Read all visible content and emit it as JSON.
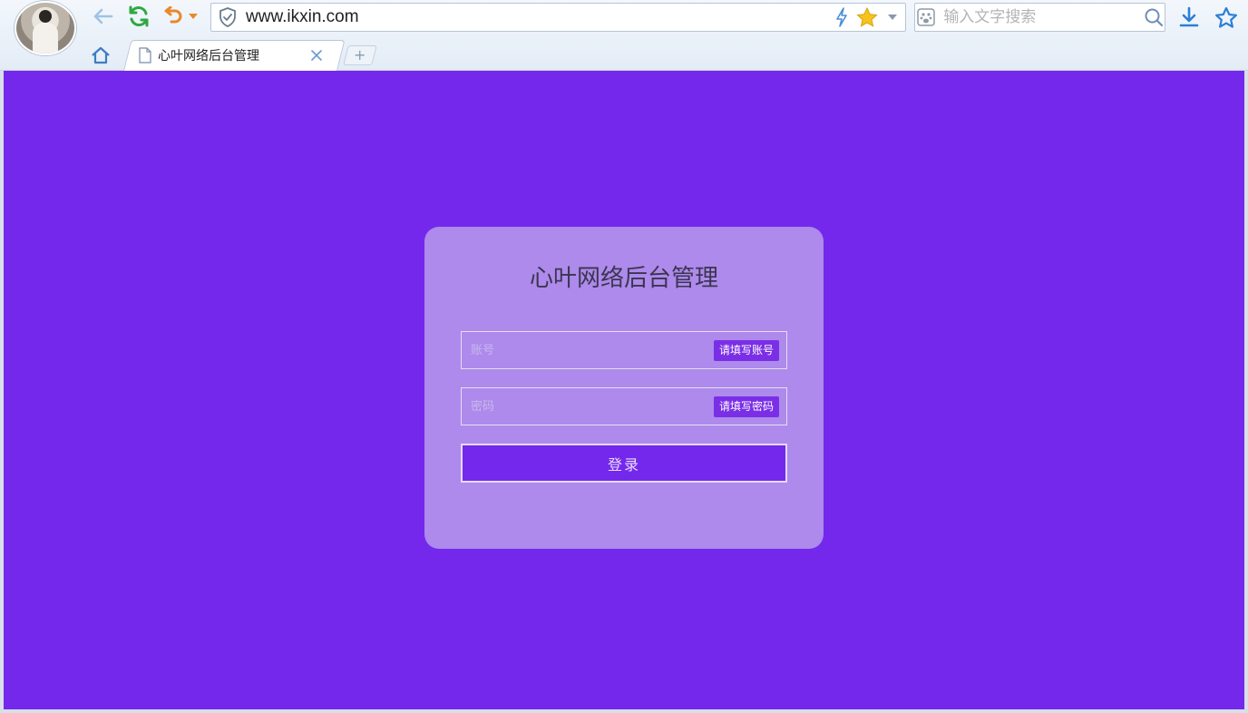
{
  "browser": {
    "address": {
      "url": "www.ikxin.com"
    },
    "search": {
      "placeholder": "输入文字搜索"
    },
    "tab": {
      "title": "心叶网络后台管理"
    },
    "new_tab_label": "+",
    "icons": {
      "back": "back-arrow-icon",
      "refresh": "refresh-icon",
      "undo": "undo-icon",
      "security": "shield-icon",
      "speed": "lightning-icon",
      "favorite": "star-icon",
      "download": "download-icon",
      "favorites_bar": "star-outline-icon",
      "home": "home-icon",
      "search": "search-icon"
    }
  },
  "page": {
    "background_color": "#7428ec",
    "card_color": "#ad8aeb",
    "login": {
      "title": "心叶网络后台管理",
      "account_placeholder": "账号",
      "account_tip": "请填写账号",
      "password_placeholder": "密码",
      "password_tip": "请填写密码",
      "submit_label": "登录"
    }
  }
}
